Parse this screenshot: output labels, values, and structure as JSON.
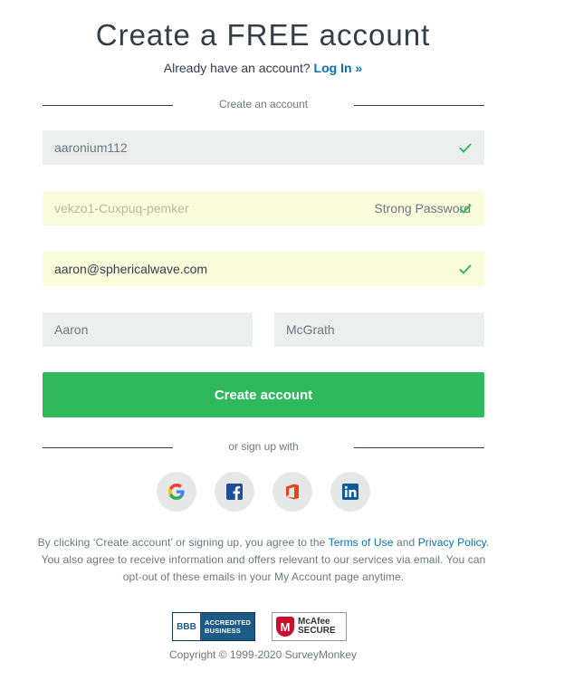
{
  "header": {
    "title": "Create a FREE account",
    "login_prompt": "Already have an account?",
    "login_link": "Log In »"
  },
  "divider_top": "Create an account",
  "form": {
    "username": "aaronium112",
    "password": "vekzo1-Cuxpuq-pemker",
    "password_strength": "Strong Password",
    "email": "aaron@sphericalwave.com",
    "first_name": "Aaron",
    "last_name": "McGrath",
    "submit_label": "Create account"
  },
  "divider_bottom": "or sign up with",
  "social": [
    "google-icon",
    "facebook-icon",
    "office-icon",
    "linkedin-icon"
  ],
  "terms": {
    "prefix": "By clicking ‘Create account’ or signing up, you agree to the",
    "terms_link": "Terms of Use",
    "and": "and",
    "privacy_link": "Privacy Policy",
    "suffix": ". You also agree to receive information and offers relevant to our services via email. You can opt-out of these emails in your My Account page anytime."
  },
  "badges": {
    "bbb_seal": "BBB",
    "bbb_line1": "ACCREDITED",
    "bbb_line2": "BUSINESS",
    "mcafee_line1": "McAfee",
    "mcafee_line2": "SECURE"
  },
  "copyright": "Copyright © 1999-2020 SurveyMonkey",
  "colors": {
    "primary_button": "#2eba5c",
    "link": "#0b6fb3",
    "check": "#2eba5c",
    "valid_field_bg": "#fafcdb"
  }
}
